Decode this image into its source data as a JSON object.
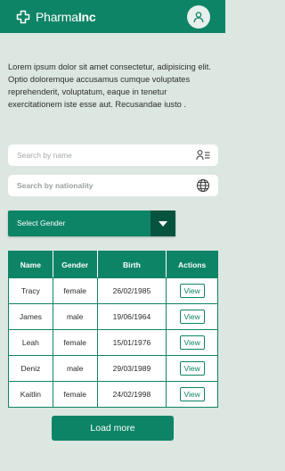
{
  "header": {
    "brand_light": "Pharma",
    "brand_bold": "Inc",
    "logo_icon": "plus-outline-icon",
    "avatar_icon": "user-icon"
  },
  "intro": {
    "text": "Lorem ipsum dolor sit amet consectetur, adipisicing elit. Optio doloremque accusamus cumque voluptates reprehenderit, voluptatum, eaque in tenetur exercitationem iste esse aut. Recusandae iusto ."
  },
  "search_name": {
    "placeholder": "Search by name",
    "icon": "person-list-icon"
  },
  "search_nationality": {
    "placeholder": "Search by nationality",
    "icon": "globe-icon"
  },
  "gender_select": {
    "label": "Select Gender",
    "icon": "caret-down-icon"
  },
  "table": {
    "headers": [
      "Name",
      "Gender",
      "Birth",
      "Actions"
    ],
    "rows": [
      {
        "name": "Tracy",
        "gender": "female",
        "birth": "26/02/1985",
        "action": "View"
      },
      {
        "name": "James",
        "gender": "male",
        "birth": "19/06/1964",
        "action": "View"
      },
      {
        "name": "Leah",
        "gender": "female",
        "birth": "15/01/1976",
        "action": "View"
      },
      {
        "name": "Deniz",
        "gender": "male",
        "birth": "29/03/1989",
        "action": "View"
      },
      {
        "name": "Kaitlin",
        "gender": "female",
        "birth": "24/02/1998",
        "action": "View"
      }
    ]
  },
  "load_more": {
    "label": "Load more"
  },
  "colors": {
    "primary": "#0e8466",
    "primary_dark": "#06533f",
    "background": "#dce7e1"
  }
}
